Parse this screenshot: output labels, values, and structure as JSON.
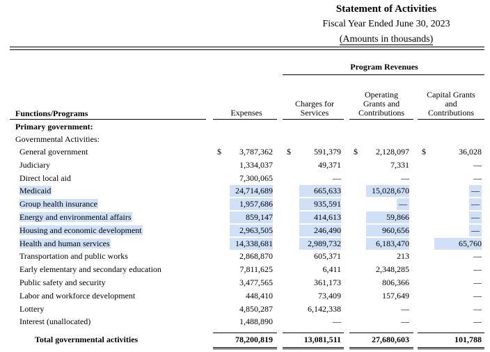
{
  "title": "Statement of Activities",
  "subtitle": "Fiscal Year Ended June 30, 2023",
  "units": "(Amounts in thousands)",
  "program_revenues_label": "Program Revenues",
  "columns": {
    "functions": "Functions/Programs",
    "expenses": "Expenses",
    "charges": [
      "Charges for",
      "Services"
    ],
    "operating": [
      "Operating",
      "Grants and",
      "Contributions"
    ],
    "capital": [
      "Capital Grants",
      "and",
      "Contributions"
    ]
  },
  "section_primary": "Primary government:",
  "section_governmental": "Governmental Activities:",
  "dollar_sign": "$",
  "rows": [
    {
      "label": "General government",
      "expenses": "3,787,362",
      "charges": "591,379",
      "operating": "2,128,097",
      "capital": "36,028",
      "highlight": false
    },
    {
      "label": "Judiciary",
      "expenses": "1,334,037",
      "charges": "49,371",
      "operating": "7,331",
      "capital": "—",
      "highlight": false
    },
    {
      "label": "Direct local aid",
      "expenses": "7,300,065",
      "charges": "—",
      "operating": "—",
      "capital": "—",
      "highlight": false
    },
    {
      "label": "Medicaid",
      "expenses": "24,714,689",
      "charges": "665,633",
      "operating": "15,028,670",
      "capital": "—",
      "highlight": true
    },
    {
      "label": "Group health insurance",
      "expenses": "1,957,686",
      "charges": "935,591",
      "operating": "—",
      "capital": "—",
      "highlight": true
    },
    {
      "label": "Energy and environmental affairs",
      "expenses": "859,147",
      "charges": "414,613",
      "operating": "59,866",
      "capital": "—",
      "highlight": true
    },
    {
      "label": "Housing and economic development",
      "expenses": "2,963,505",
      "charges": "246,490",
      "operating": "960,656",
      "capital": "—",
      "highlight": true
    },
    {
      "label": "Health and human services",
      "expenses": "14,338,681",
      "charges": "2,989,732",
      "operating": "6,183,470",
      "capital": "65,760",
      "highlight": true
    },
    {
      "label": "Transportation and public works",
      "expenses": "2,868,870",
      "charges": "605,371",
      "operating": "213",
      "capital": "—",
      "highlight": false
    },
    {
      "label": "Early elementary and secondary education",
      "expenses": "7,811,625",
      "charges": "6,411",
      "operating": "2,348,285",
      "capital": "—",
      "highlight": false
    },
    {
      "label": "Public safety and security",
      "expenses": "3,477,565",
      "charges": "361,173",
      "operating": "806,366",
      "capital": "—",
      "highlight": false
    },
    {
      "label": "Labor and workforce development",
      "expenses": "448,410",
      "charges": "73,409",
      "operating": "157,649",
      "capital": "—",
      "highlight": false
    },
    {
      "label": "Lottery",
      "expenses": "4,850,287",
      "charges": "6,142,338",
      "operating": "—",
      "capital": "—",
      "highlight": false
    },
    {
      "label": "Interest (unallocated)",
      "expenses": "1,488,890",
      "charges": "—",
      "operating": "—",
      "capital": "—",
      "highlight": false
    }
  ],
  "total": {
    "label": "Total governmental activities",
    "expenses": "78,200,819",
    "charges": "13,081,511",
    "operating": "27,680,603",
    "capital": "101,788"
  },
  "highlight_color": "#cfe0f7"
}
